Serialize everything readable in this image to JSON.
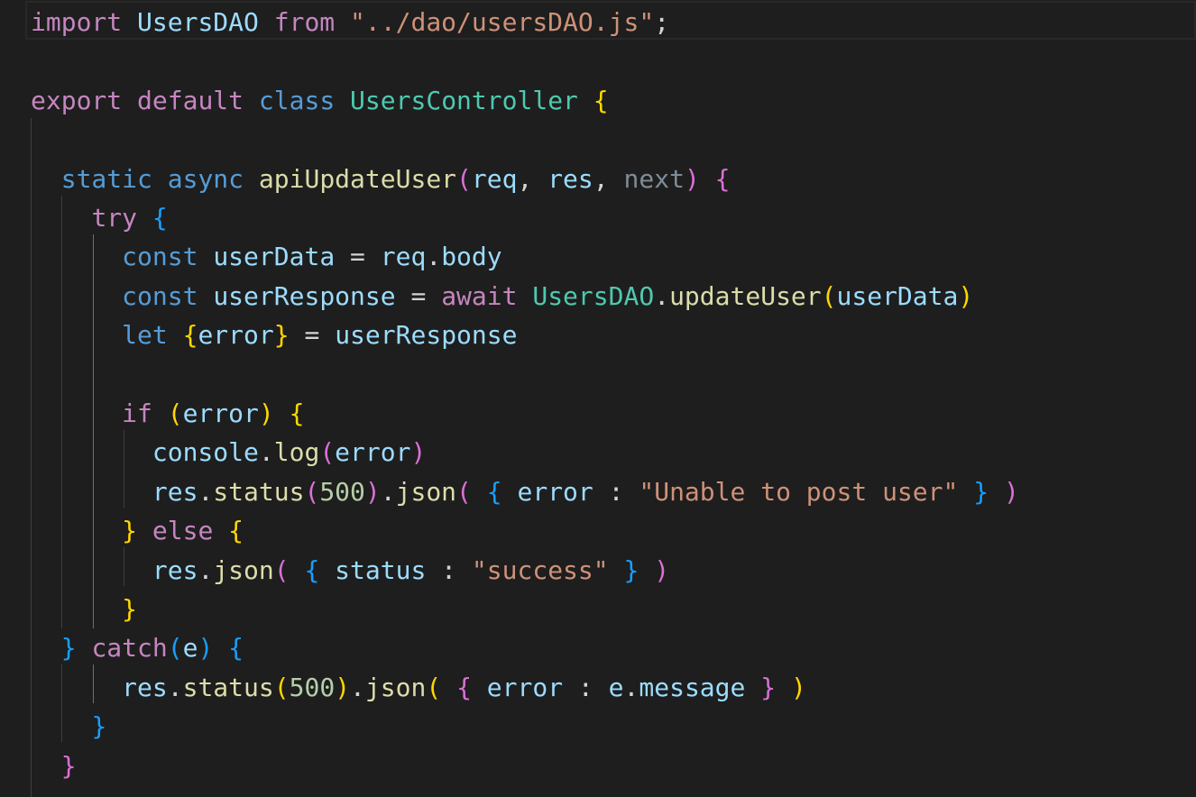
{
  "editor": {
    "file_language": "javascript",
    "lines": [
      [
        [
          "kw-ctrl",
          "import"
        ],
        [
          "op",
          " "
        ],
        [
          "var",
          "UsersDAO"
        ],
        [
          "op",
          " "
        ],
        [
          "kw-ctrl",
          "from"
        ],
        [
          "op",
          " "
        ],
        [
          "str",
          "\"../dao/usersDAO.js\""
        ],
        [
          "op",
          ";"
        ]
      ],
      [],
      [
        [
          "kw-ctrl",
          "export"
        ],
        [
          "op",
          " "
        ],
        [
          "kw-ctrl",
          "default"
        ],
        [
          "op",
          " "
        ],
        [
          "kw",
          "class"
        ],
        [
          "op",
          " "
        ],
        [
          "cls",
          "UsersController"
        ],
        [
          "op",
          " "
        ],
        [
          "b1",
          "{"
        ]
      ],
      [],
      [
        [
          "op",
          "  "
        ],
        [
          "kw",
          "static"
        ],
        [
          "op",
          " "
        ],
        [
          "kw",
          "async"
        ],
        [
          "op",
          " "
        ],
        [
          "fn",
          "apiUpdateUser"
        ],
        [
          "b2",
          "("
        ],
        [
          "var",
          "req"
        ],
        [
          "op",
          ", "
        ],
        [
          "var",
          "res"
        ],
        [
          "op",
          ", "
        ],
        [
          "unused",
          "next"
        ],
        [
          "b2",
          ")"
        ],
        [
          "op",
          " "
        ],
        [
          "b2",
          "{"
        ]
      ],
      [
        [
          "op",
          "    "
        ],
        [
          "kw-ctrl",
          "try"
        ],
        [
          "op",
          " "
        ],
        [
          "b3",
          "{"
        ]
      ],
      [
        [
          "op",
          "      "
        ],
        [
          "kw",
          "const"
        ],
        [
          "op",
          " "
        ],
        [
          "var",
          "userData"
        ],
        [
          "op",
          " = "
        ],
        [
          "var",
          "req"
        ],
        [
          "op",
          "."
        ],
        [
          "var",
          "body"
        ]
      ],
      [
        [
          "op",
          "      "
        ],
        [
          "kw",
          "const"
        ],
        [
          "op",
          " "
        ],
        [
          "var",
          "userResponse"
        ],
        [
          "op",
          " = "
        ],
        [
          "kw-ctrl",
          "await"
        ],
        [
          "op",
          " "
        ],
        [
          "cls",
          "UsersDAO"
        ],
        [
          "op",
          "."
        ],
        [
          "fn",
          "updateUser"
        ],
        [
          "b1",
          "("
        ],
        [
          "var",
          "userData"
        ],
        [
          "b1",
          ")"
        ]
      ],
      [
        [
          "op",
          "      "
        ],
        [
          "kw",
          "let"
        ],
        [
          "op",
          " "
        ],
        [
          "b1",
          "{"
        ],
        [
          "var",
          "error"
        ],
        [
          "b1",
          "}"
        ],
        [
          "op",
          " = "
        ],
        [
          "var",
          "userResponse"
        ]
      ],
      [],
      [
        [
          "op",
          "      "
        ],
        [
          "kw-ctrl",
          "if"
        ],
        [
          "op",
          " "
        ],
        [
          "b1",
          "("
        ],
        [
          "var",
          "error"
        ],
        [
          "b1",
          ")"
        ],
        [
          "op",
          " "
        ],
        [
          "b1",
          "{"
        ]
      ],
      [
        [
          "op",
          "        "
        ],
        [
          "var",
          "console"
        ],
        [
          "op",
          "."
        ],
        [
          "fn",
          "log"
        ],
        [
          "b2",
          "("
        ],
        [
          "var",
          "error"
        ],
        [
          "b2",
          ")"
        ]
      ],
      [
        [
          "op",
          "        "
        ],
        [
          "var",
          "res"
        ],
        [
          "op",
          "."
        ],
        [
          "fn",
          "status"
        ],
        [
          "b2",
          "("
        ],
        [
          "num",
          "500"
        ],
        [
          "b2",
          ")"
        ],
        [
          "op",
          "."
        ],
        [
          "fn",
          "json"
        ],
        [
          "b2",
          "("
        ],
        [
          "op",
          " "
        ],
        [
          "b3",
          "{"
        ],
        [
          "op",
          " "
        ],
        [
          "var",
          "error"
        ],
        [
          "op",
          " : "
        ],
        [
          "str",
          "\"Unable to post user\""
        ],
        [
          "op",
          " "
        ],
        [
          "b3",
          "}"
        ],
        [
          "op",
          " "
        ],
        [
          "b2",
          ")"
        ]
      ],
      [
        [
          "op",
          "      "
        ],
        [
          "b1",
          "}"
        ],
        [
          "op",
          " "
        ],
        [
          "kw-ctrl",
          "else"
        ],
        [
          "op",
          " "
        ],
        [
          "b1",
          "{"
        ]
      ],
      [
        [
          "op",
          "        "
        ],
        [
          "var",
          "res"
        ],
        [
          "op",
          "."
        ],
        [
          "fn",
          "json"
        ],
        [
          "b2",
          "("
        ],
        [
          "op",
          " "
        ],
        [
          "b3",
          "{"
        ],
        [
          "op",
          " "
        ],
        [
          "var",
          "status"
        ],
        [
          "op",
          " : "
        ],
        [
          "str",
          "\"success\""
        ],
        [
          "op",
          " "
        ],
        [
          "b3",
          "}"
        ],
        [
          "op",
          " "
        ],
        [
          "b2",
          ")"
        ]
      ],
      [
        [
          "op",
          "      "
        ],
        [
          "b1",
          "}"
        ]
      ],
      [
        [
          "op",
          "  "
        ],
        [
          "b3",
          "}"
        ],
        [
          "op",
          " "
        ],
        [
          "kw-ctrl",
          "catch"
        ],
        [
          "b3",
          "("
        ],
        [
          "var",
          "e"
        ],
        [
          "b3",
          ")"
        ],
        [
          "op",
          " "
        ],
        [
          "b3",
          "{"
        ]
      ],
      [
        [
          "op",
          "      "
        ],
        [
          "var",
          "res"
        ],
        [
          "op",
          "."
        ],
        [
          "fn",
          "status"
        ],
        [
          "b1",
          "("
        ],
        [
          "num",
          "500"
        ],
        [
          "b1",
          ")"
        ],
        [
          "op",
          "."
        ],
        [
          "fn",
          "json"
        ],
        [
          "b1",
          "("
        ],
        [
          "op",
          " "
        ],
        [
          "b2",
          "{"
        ],
        [
          "op",
          " "
        ],
        [
          "var",
          "error"
        ],
        [
          "op",
          " : "
        ],
        [
          "var",
          "e"
        ],
        [
          "op",
          "."
        ],
        [
          "var",
          "message"
        ],
        [
          "op",
          " "
        ],
        [
          "b2",
          "}"
        ],
        [
          "op",
          " "
        ],
        [
          "b1",
          ")"
        ]
      ],
      [
        [
          "op",
          "    "
        ],
        [
          "b3",
          "}"
        ]
      ],
      [
        [
          "op",
          "  "
        ],
        [
          "b2",
          "}"
        ]
      ]
    ]
  }
}
